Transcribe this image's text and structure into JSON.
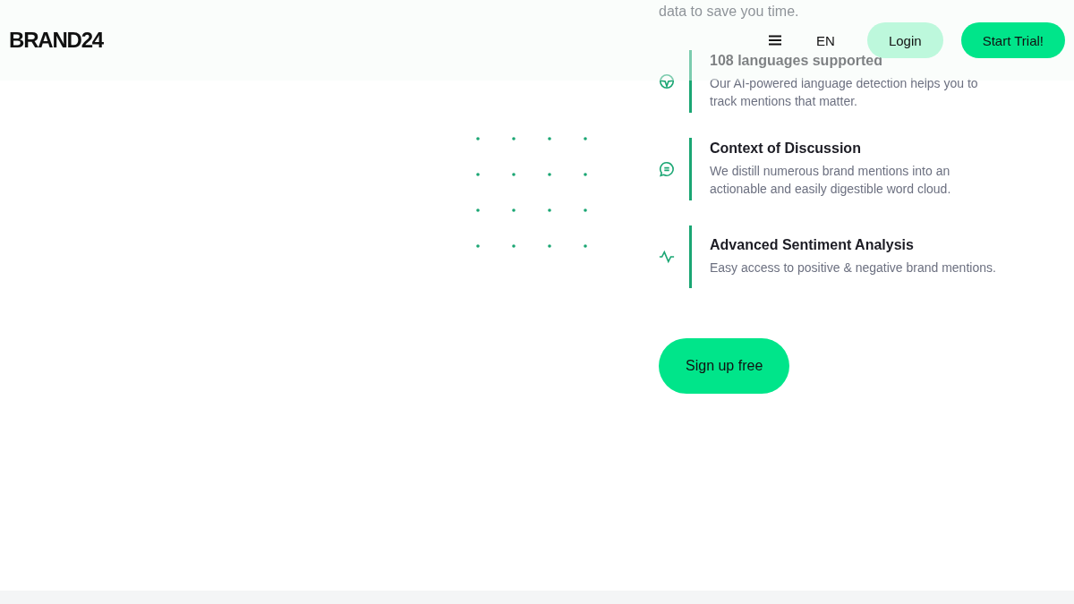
{
  "header": {
    "logo": "BRAND24",
    "language": "EN",
    "login": "Login",
    "cta": "Start Trial!"
  },
  "intro": "data to save you time.",
  "features": [
    {
      "title": "108 languages supported",
      "text": "Our AI-powered language detection helps you to track mentions that matter."
    },
    {
      "title": "Context of Discussion",
      "text": "We distill numerous brand mentions into an actionable and easily digestible word cloud."
    },
    {
      "title": "Advanced Sentiment Analysis",
      "text": "Easy access to positive & negative brand mentions."
    }
  ],
  "signup": "Sign up free"
}
